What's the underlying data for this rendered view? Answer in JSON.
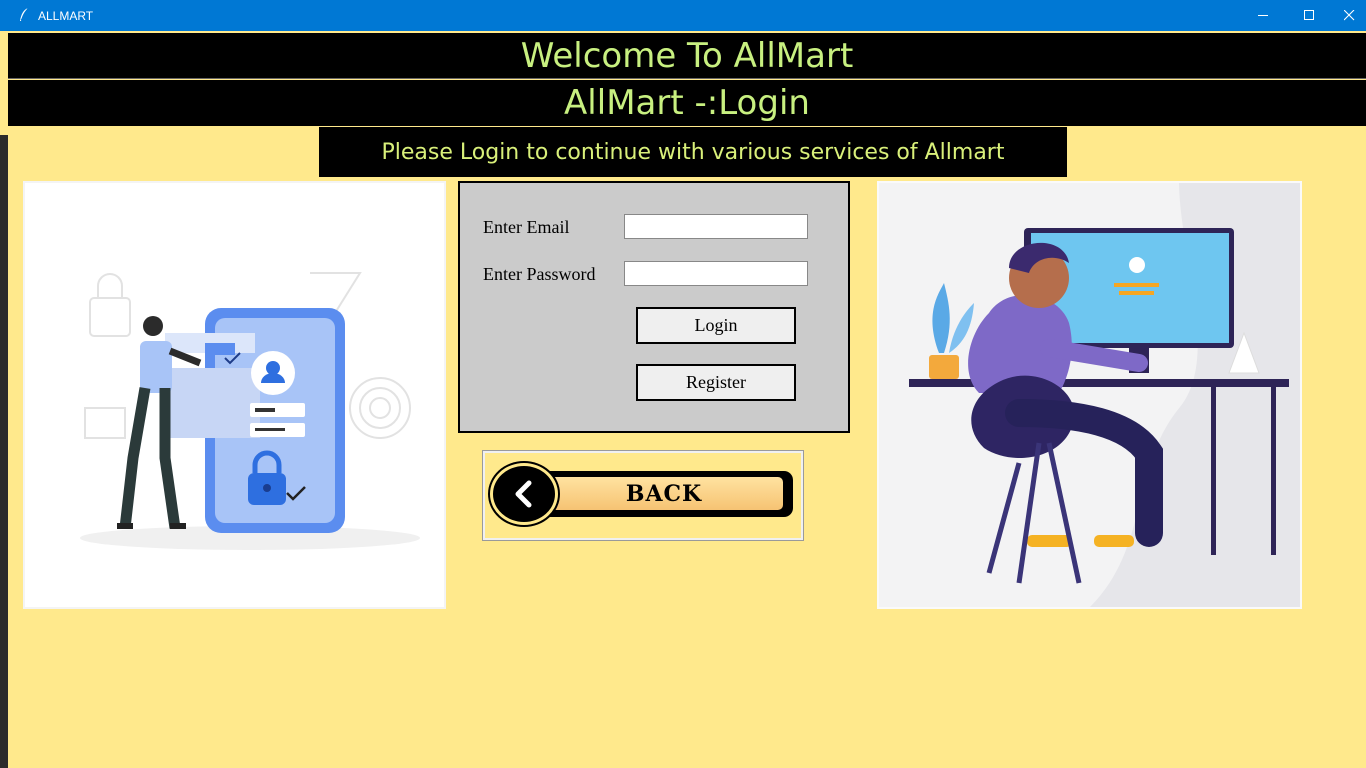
{
  "window": {
    "title": "ALLMART",
    "icons": {
      "app": "feather-icon",
      "minimize": "minimize-icon",
      "maximize": "maximize-icon",
      "close": "close-icon"
    }
  },
  "header": {
    "welcome": "Welcome To AllMart",
    "login_title": "AllMart -:Login",
    "subtitle": "Please Login to continue with various services of  Allmart"
  },
  "login_form": {
    "email_label": "Enter Email",
    "email_value": "",
    "password_label": "Enter Password",
    "password_value": "",
    "login_button": "Login",
    "register_button": "Register"
  },
  "back": {
    "label": "BACK",
    "icon": "chevron-left-icon"
  },
  "illustrations": {
    "left": "security-login-illustration",
    "right": "person-at-computer-illustration"
  },
  "colors": {
    "background": "#FFE98C",
    "banner": "#000000",
    "banner_text": "#C8F080",
    "titlebar": "#0078D4",
    "panel": "#CBCBCB"
  }
}
